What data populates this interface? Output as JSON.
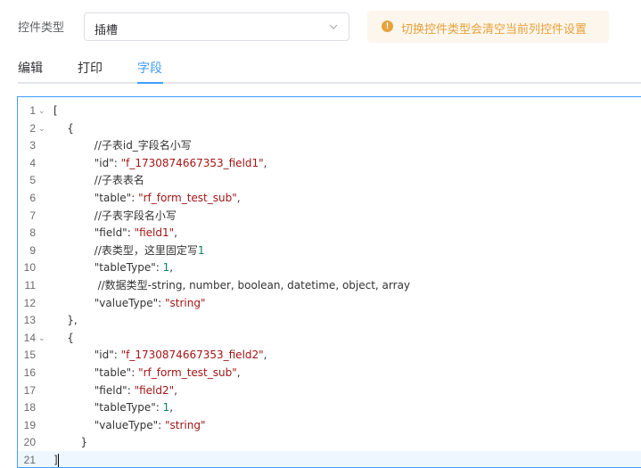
{
  "form": {
    "type_label": "控件类型",
    "type_value": "插槽",
    "warning": "切换控件类型会清空当前列控件设置",
    "warning_icon": "!"
  },
  "tabs": [
    {
      "label": "编辑",
      "active": false
    },
    {
      "label": "打印",
      "active": false
    },
    {
      "label": "字段",
      "active": true
    }
  ],
  "colors": {
    "accent": "#409eff",
    "warning": "#e6a23c",
    "warning_bg": "#fdf6ec",
    "string": "#a31515",
    "number": "#098658"
  },
  "editor": {
    "active_line": 21,
    "lines": [
      {
        "n": "1",
        "fold": true,
        "text": "["
      },
      {
        "n": "2",
        "fold": true,
        "text": "    {"
      },
      {
        "n": "3",
        "fold": false,
        "text": "            //子表id_字段名小写"
      },
      {
        "n": "4",
        "fold": false,
        "text": "            \"id\": \"f_1730874667353_field1\","
      },
      {
        "n": "5",
        "fold": false,
        "text": "            //子表表名"
      },
      {
        "n": "6",
        "fold": false,
        "text": "            \"table\": \"rf_form_test_sub\","
      },
      {
        "n": "7",
        "fold": false,
        "text": "            //子表字段名小写"
      },
      {
        "n": "8",
        "fold": false,
        "text": "            \"field\": \"field1\","
      },
      {
        "n": "9",
        "fold": false,
        "text": "            //表类型，这里固定写1"
      },
      {
        "n": "10",
        "fold": false,
        "text": "            \"tableType\": 1,"
      },
      {
        "n": "11",
        "fold": false,
        "text": "             //数据类型-string, number, boolean, datetime, object, array"
      },
      {
        "n": "12",
        "fold": false,
        "text": "            \"valueType\": \"string\""
      },
      {
        "n": "13",
        "fold": false,
        "text": "    },"
      },
      {
        "n": "14",
        "fold": true,
        "text": "    {"
      },
      {
        "n": "15",
        "fold": false,
        "text": "            \"id\": \"f_1730874667353_field2\","
      },
      {
        "n": "16",
        "fold": false,
        "text": "            \"table\": \"rf_form_test_sub\","
      },
      {
        "n": "17",
        "fold": false,
        "text": "            \"field\": \"field2\","
      },
      {
        "n": "18",
        "fold": false,
        "text": "            \"tableType\": 1,"
      },
      {
        "n": "19",
        "fold": false,
        "text": "            \"valueType\": \"string\""
      },
      {
        "n": "20",
        "fold": false,
        "text": "        }"
      },
      {
        "n": "21",
        "fold": false,
        "text": "]"
      }
    ]
  }
}
